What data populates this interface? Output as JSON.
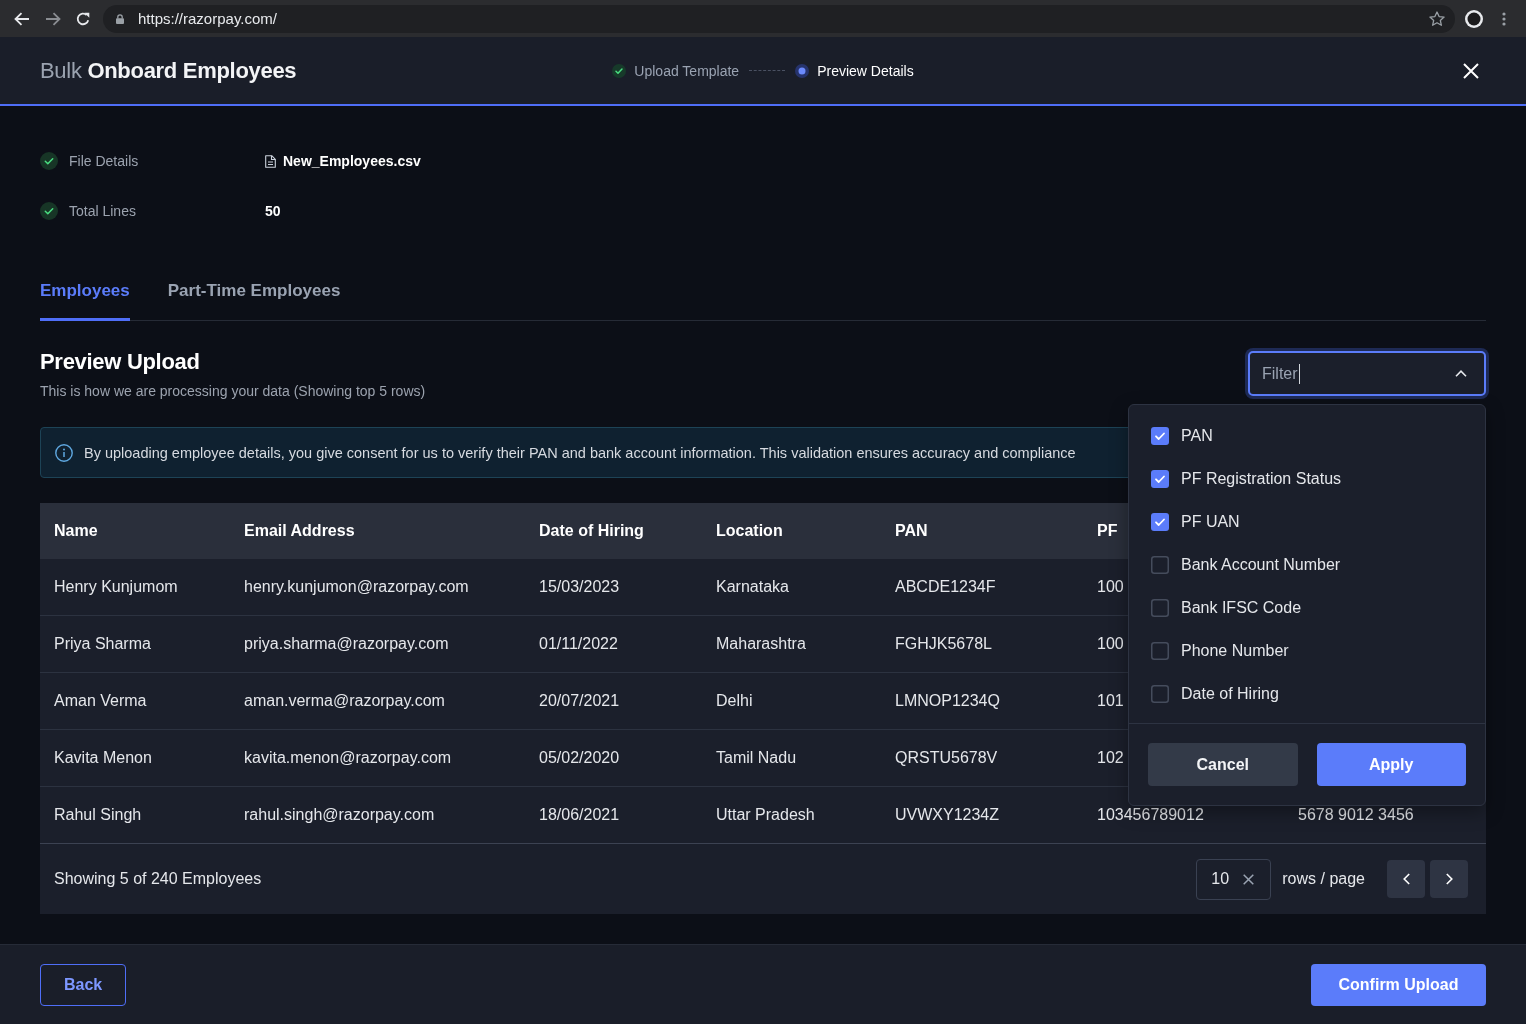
{
  "browser": {
    "url": "https://razorpay.com/"
  },
  "header": {
    "title": "Bulk **Onboard Employees**",
    "steps": [
      {
        "label": "Upload Template",
        "completed": true,
        "selected": false
      },
      {
        "label": "Preview Details",
        "completed": false,
        "selected": true
      }
    ]
  },
  "file_summary": [
    {
      "label": "File Details",
      "value": "New_Employees.csv",
      "kind": "file",
      "valid": true
    },
    {
      "label": "Total Lines",
      "value": "50",
      "kind": "count",
      "valid": true
    }
  ],
  "tabs": [
    {
      "label": "Employees",
      "selected": true
    },
    {
      "label": "Part-Time Employees",
      "selected": false
    }
  ],
  "preview": {
    "title": "Preview Upload",
    "subtitle": "This is how we are processing your data (Showing top 5 rows)"
  },
  "notice": {
    "text": "By uploading employee details, you give consent for us to verify their PAN and bank account information. This validation ensures accuracy and compliance"
  },
  "filter": {
    "placeholder": "Filter",
    "expanded": true,
    "options": [
      {
        "label": "PAN",
        "checked": true
      },
      {
        "label": "PF Registration Status",
        "checked": true
      },
      {
        "label": "PF UAN",
        "checked": true
      },
      {
        "label": "Bank Account Number",
        "checked": false
      },
      {
        "label": "Bank IFSC Code",
        "checked": false
      },
      {
        "label": "Phone Number",
        "checked": false
      },
      {
        "label": "Date of Hiring",
        "checked": false
      }
    ],
    "buttons": [
      {
        "label": "Cancel",
        "kind": "secondary"
      },
      {
        "label": "Apply",
        "kind": "primary"
      }
    ]
  },
  "table": {
    "columns": [
      "Name",
      "Email Address",
      "Date of Hiring",
      "Location",
      "PAN",
      "PF"
    ],
    "rows": [
      [
        "Henry Kunjumom",
        "henry.kunjumon@razorpay.com",
        "15/03/2023",
        "Karnataka",
        "ABCDE1234F",
        "100"
      ],
      [
        "Priya Sharma",
        "priya.sharma@razorpay.com",
        "01/11/2022",
        "Maharashtra",
        "FGHJK5678L",
        "100"
      ],
      [
        "Aman Verma",
        "aman.verma@razorpay.com",
        "20/07/2021",
        "Delhi",
        "LMNOP1234Q",
        "101"
      ],
      [
        "Kavita Menon",
        "kavita.menon@razorpay.com",
        "05/02/2020",
        "Tamil Nadu",
        "QRSTU5678V",
        "102"
      ],
      [
        "Rahul Singh",
        "rahul.singh@razorpay.com",
        "18/06/2021",
        "Uttar Pradesh",
        "UVWXY1234Z",
        "103456789012",
        "5678 9012 3456"
      ]
    ],
    "summary": "Showing 5 of 240 Employees",
    "rows_per_page": {
      "value": "10"
    },
    "rows_per_page_label": "rows / page"
  },
  "footer": {
    "buttons": [
      {
        "label": "Back",
        "kind": "outline"
      },
      {
        "label": "Confirm Upload",
        "kind": "primary"
      }
    ]
  }
}
